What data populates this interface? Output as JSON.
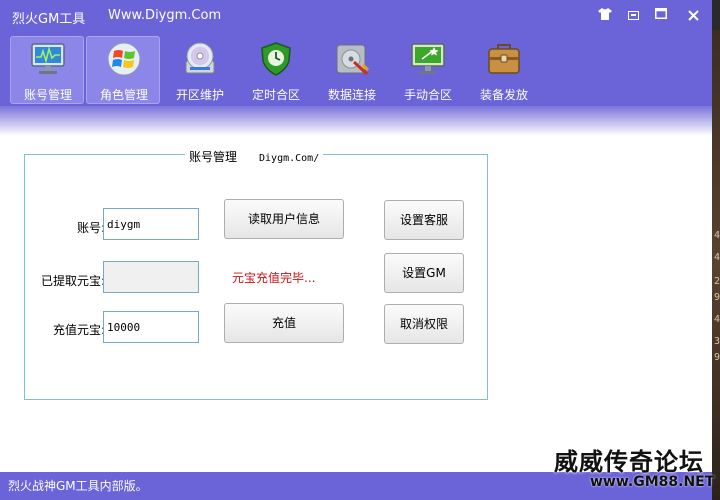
{
  "titlebar": {
    "title": "烈火GM工具",
    "url": "Www.Diygm.Com"
  },
  "toolbar": {
    "items": [
      {
        "label": "账号管理",
        "icon": "monitor-icon"
      },
      {
        "label": "角色管理",
        "icon": "windows-logo-icon"
      },
      {
        "label": "开区维护",
        "icon": "disc-icon"
      },
      {
        "label": "定时合区",
        "icon": "shield-clock-icon"
      },
      {
        "label": "数据连接",
        "icon": "database-tools-icon"
      },
      {
        "label": "手动合区",
        "icon": "monitor-star-icon"
      },
      {
        "label": "装备发放",
        "icon": "toolbox-icon"
      }
    ]
  },
  "account_panel": {
    "group_title": "账号管理",
    "group_title_suffix": "Diygm.Com/",
    "account_label": "账号:",
    "account_value": "diygm",
    "extracted_label": "已提取元宝:",
    "extracted_value": "",
    "recharge_label": "充值元宝:",
    "recharge_value": "10000",
    "read_user_button": "读取用户信息",
    "recharge_button": "充值",
    "status_message": "元宝充值完毕...",
    "set_service_button": "设置客服",
    "set_gm_button": "设置GM",
    "revoke_button": "取消权限"
  },
  "statusbar": {
    "text": "烈火战神GM工具内部版。"
  },
  "watermark": {
    "line1": "威威传奇论坛",
    "line2": "www.GM88.NET"
  },
  "background_edge_digits": [
    "4",
    "4",
    "2",
    "9",
    "4",
    "3",
    "9"
  ],
  "colors": {
    "chrome": "#6b63d8",
    "status_text": "#cc1111",
    "group_border": "#7ec0d8"
  }
}
